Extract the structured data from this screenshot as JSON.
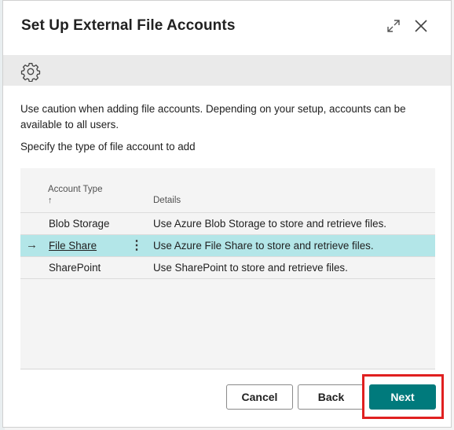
{
  "dialog": {
    "title": "Set Up External File Accounts",
    "caution_text": "Use caution when adding file accounts. Depending on your setup, accounts can be available to all users.",
    "instruction_text": "Specify the type of file account to add"
  },
  "header_icons": [
    "expand-icon",
    "close-icon"
  ],
  "toolbar": {
    "icon": "gear-icon"
  },
  "grid": {
    "columns": {
      "account_type": "Account Type",
      "sort_indicator": "↑",
      "details": "Details"
    },
    "rows": [
      {
        "account_type": "Blob Storage",
        "details": "Use Azure Blob Storage to store and retrieve files.",
        "selected": false
      },
      {
        "account_type": "File Share",
        "details": "Use Azure File Share to store and retrieve files.",
        "selected": true
      },
      {
        "account_type": "SharePoint",
        "details": "Use SharePoint to store and retrieve files.",
        "selected": false
      }
    ],
    "row_arrow": "→",
    "row_menu": "⋮"
  },
  "buttons": {
    "cancel": "Cancel",
    "back": "Back",
    "next": "Next"
  },
  "colors": {
    "primary": "#007a7c",
    "selected_row": "#b3e6e8",
    "highlight": "#e02020"
  }
}
